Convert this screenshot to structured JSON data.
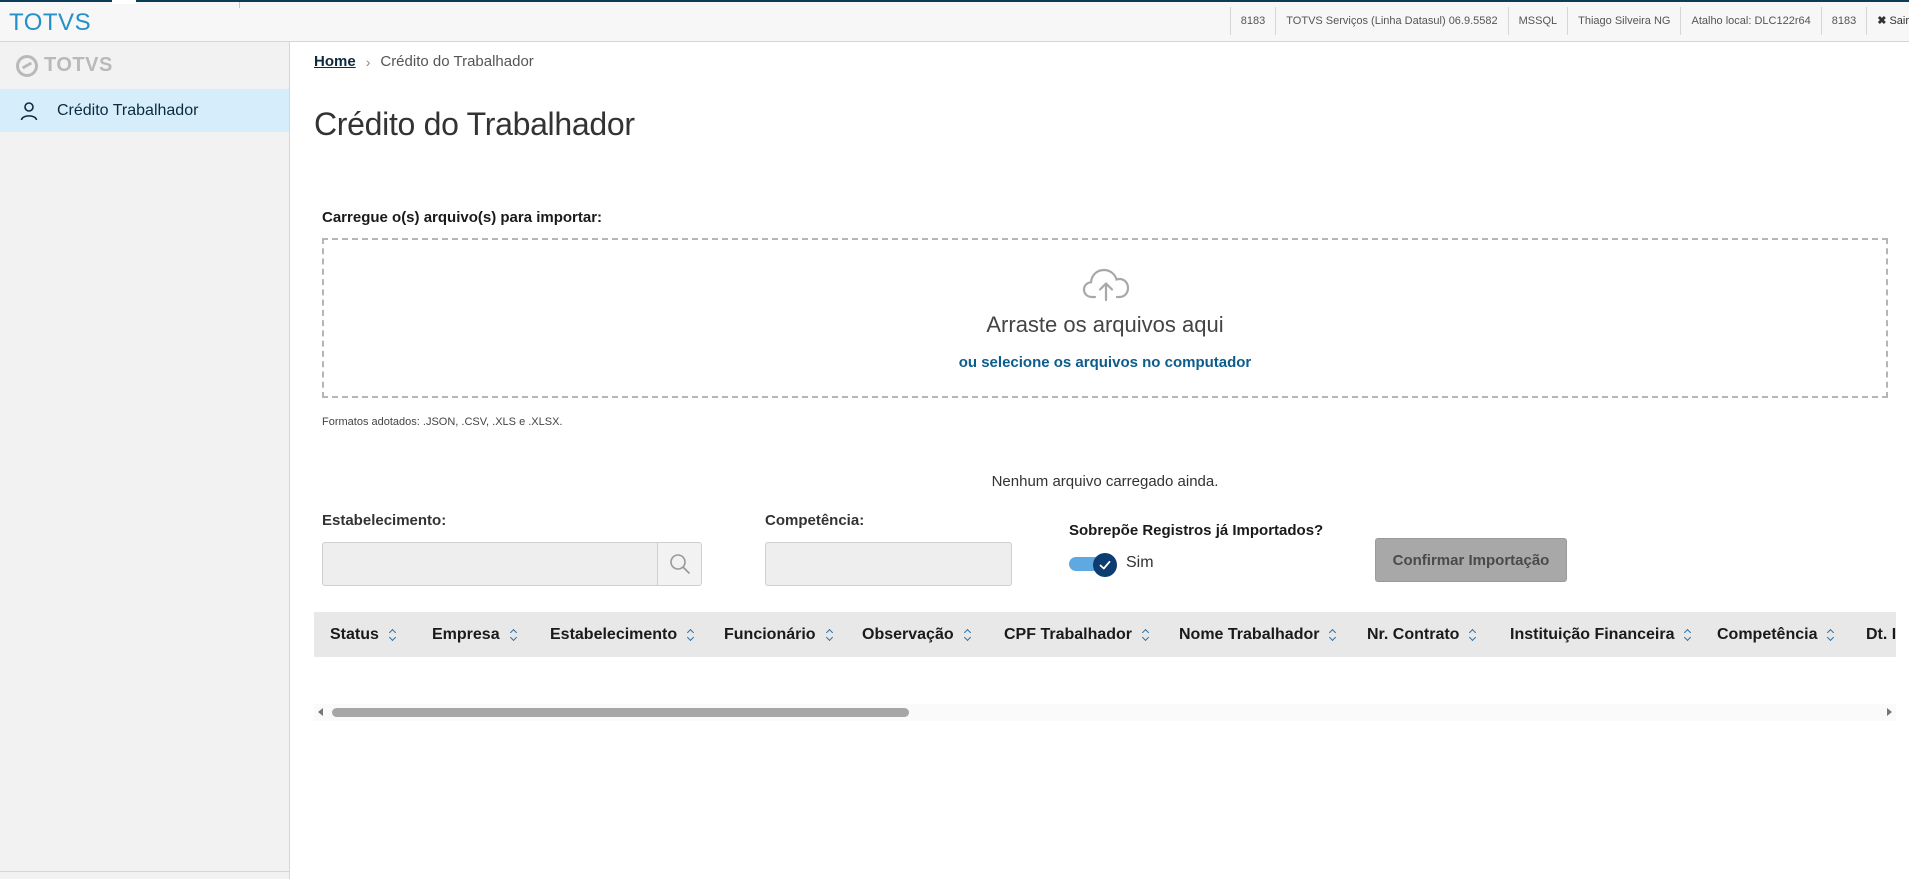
{
  "topbar": {
    "brand": "TOTVS",
    "status": [
      "8183",
      "TOTVS Serviços (Linha Datasul) 06.9.5582",
      "MSSQL",
      "Thiago Silveira NG",
      "Atalho local: DLC122r64",
      "8183"
    ],
    "exit_label": "Sair"
  },
  "sidebar": {
    "logo_text": "TOTVS",
    "items": [
      {
        "label": "Crédito Trabalhador",
        "icon": "user-icon",
        "active": true
      }
    ]
  },
  "breadcrumb": {
    "home": "Home",
    "current": "Crédito do Trabalhador"
  },
  "page_title": "Crédito do Trabalhador",
  "upload": {
    "label": "Carregue o(s) arquivo(s) para importar:",
    "drop_title": "Arraste os arquivos aqui",
    "drop_link": "ou selecione os arquivos no computador",
    "formats": "Formatos adotados: .JSON, .CSV, .XLS e .XLSX.",
    "empty_message": "Nenhum arquivo carregado ainda."
  },
  "form": {
    "estabelecimento_label": "Estabelecimento:",
    "estabelecimento_value": "",
    "competencia_label": "Competência:",
    "competencia_value": "",
    "sobrepoe_label": "Sobrepõe Registros já Importados?",
    "sobrepoe_value": "Sim",
    "confirm_label": "Confirmar Importação"
  },
  "table": {
    "columns": [
      "Status",
      "Empresa",
      "Estabelecimento",
      "Funcionário",
      "Observação",
      "CPF Trabalhador",
      "Nome Trabalhador",
      "Nr. Contrato",
      "Instituição Financeira",
      "Competência",
      "Dt. I"
    ]
  },
  "colors": {
    "brand": "#2590c8",
    "active_item_bg": "#d6eefb",
    "link": "#0c5c8c",
    "toggle_knob": "#0c3c70",
    "toggle_track": "#5fa9e2"
  }
}
